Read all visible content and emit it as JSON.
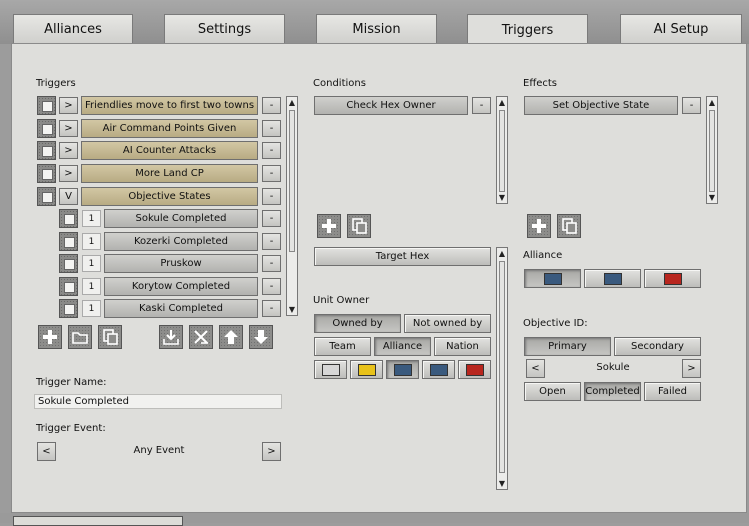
{
  "tabs": [
    "Alliances",
    "Settings",
    "Mission",
    "Triggers",
    "AI Setup"
  ],
  "active_tab": "Triggers",
  "triggers": {
    "heading": "Triggers",
    "items": [
      {
        "toggle": ">",
        "label": "Friendlies move to first two towns",
        "remove": "-"
      },
      {
        "toggle": ">",
        "label": "Air Command Points Given",
        "remove": "-"
      },
      {
        "toggle": ">",
        "label": "AI Counter Attacks",
        "remove": "-"
      },
      {
        "toggle": ">",
        "label": "More Land CP",
        "remove": "-"
      },
      {
        "toggle": "V",
        "label": "Objective States",
        "remove": "-"
      }
    ],
    "subitems": [
      {
        "index": "1",
        "label": "Sokule Completed",
        "remove": "-"
      },
      {
        "index": "1",
        "label": "Kozerki Completed",
        "remove": "-"
      },
      {
        "index": "1",
        "label": "Pruskow",
        "remove": "-"
      },
      {
        "index": "1",
        "label": "Korytow Completed",
        "remove": "-"
      },
      {
        "index": "1",
        "label": "Kaski Completed",
        "remove": "-"
      }
    ],
    "name_label": "Trigger Name:",
    "name_value": "Sokule Completed",
    "event_label": "Trigger Event:",
    "event_prev": "<",
    "event_value": "Any Event",
    "event_next": ">"
  },
  "conditions": {
    "heading": "Conditions",
    "items": [
      {
        "label": "Check Hex Owner",
        "remove": "-"
      }
    ],
    "target_hex": "Target Hex",
    "unit_owner_label": "Unit Owner",
    "owned_by": "Owned by",
    "not_owned_by": "Not owned by",
    "team": "Team",
    "alliance": "Alliance",
    "nation": "Nation",
    "colors": [
      "#d6d6d6",
      "#e8c21a",
      "#3a5a7e",
      "#3a5a7e",
      "#b8261e"
    ]
  },
  "effects": {
    "heading": "Effects",
    "items": [
      {
        "label": "Set Objective State",
        "remove": "-"
      }
    ],
    "alliance_label": "Alliance",
    "alliance_colors": [
      "#3a5a7e",
      "#3a5a7e",
      "#b8261e"
    ],
    "objective_label": "Objective ID:",
    "primary": "Primary",
    "secondary": "Secondary",
    "obj_prev": "<",
    "obj_value": "Sokule",
    "obj_next": ">",
    "state_open": "Open",
    "state_completed": "Completed",
    "state_failed": "Failed"
  },
  "scroll_up": "▲",
  "scroll_down": "▼"
}
